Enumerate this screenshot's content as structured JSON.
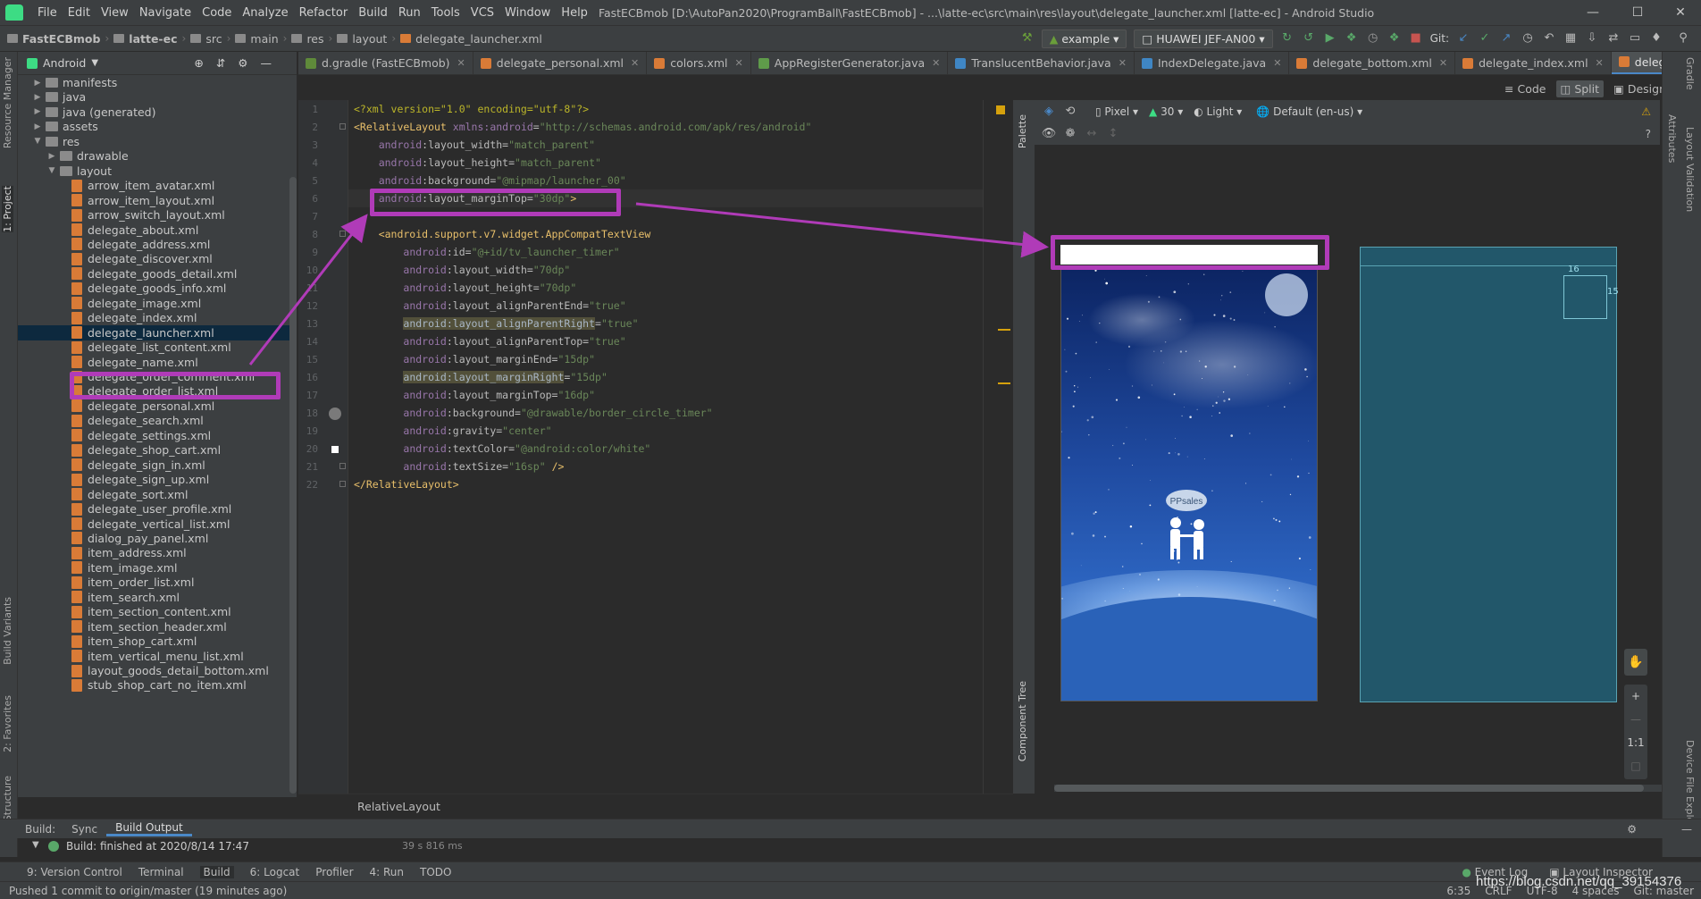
{
  "window": {
    "title": "FastECBmob [D:\\AutoPan2020\\ProgramBall\\FastECBmob] - ...\\latte-ec\\src\\main\\res\\layout\\delegate_launcher.xml [latte-ec] - Android Studio",
    "menu": [
      "File",
      "Edit",
      "View",
      "Navigate",
      "Code",
      "Analyze",
      "Refactor",
      "Build",
      "Run",
      "Tools",
      "VCS",
      "Window",
      "Help"
    ]
  },
  "breadcrumb": [
    "FastECBmob",
    "latte-ec",
    "src",
    "main",
    "res",
    "layout",
    "delegate_launcher.xml"
  ],
  "run": {
    "config": "example",
    "device": "HUAWEI JEF-AN00",
    "git_label": "Git:"
  },
  "project": {
    "view_label": "Android",
    "tree": [
      {
        "depth": 1,
        "type": "folder",
        "label": "manifests",
        "open": false
      },
      {
        "depth": 1,
        "type": "folder",
        "label": "java",
        "open": false
      },
      {
        "depth": 1,
        "type": "folder",
        "label": "java (generated)",
        "open": false
      },
      {
        "depth": 1,
        "type": "folder",
        "label": "assets",
        "open": false
      },
      {
        "depth": 1,
        "type": "folder",
        "label": "res",
        "open": true
      },
      {
        "depth": 2,
        "type": "folder",
        "label": "drawable",
        "open": false
      },
      {
        "depth": 2,
        "type": "folder",
        "label": "layout",
        "open": true
      },
      {
        "depth": 3,
        "type": "file",
        "label": "arrow_item_avatar.xml"
      },
      {
        "depth": 3,
        "type": "file",
        "label": "arrow_item_layout.xml"
      },
      {
        "depth": 3,
        "type": "file",
        "label": "arrow_switch_layout.xml"
      },
      {
        "depth": 3,
        "type": "file",
        "label": "delegate_about.xml"
      },
      {
        "depth": 3,
        "type": "file",
        "label": "delegate_address.xml"
      },
      {
        "depth": 3,
        "type": "file",
        "label": "delegate_discover.xml"
      },
      {
        "depth": 3,
        "type": "file",
        "label": "delegate_goods_detail.xml"
      },
      {
        "depth": 3,
        "type": "file",
        "label": "delegate_goods_info.xml"
      },
      {
        "depth": 3,
        "type": "file",
        "label": "delegate_image.xml"
      },
      {
        "depth": 3,
        "type": "file",
        "label": "delegate_index.xml"
      },
      {
        "depth": 3,
        "type": "file",
        "label": "delegate_launcher.xml",
        "selected": true
      },
      {
        "depth": 3,
        "type": "file",
        "label": "delegate_list_content.xml"
      },
      {
        "depth": 3,
        "type": "file",
        "label": "delegate_name.xml"
      },
      {
        "depth": 3,
        "type": "file",
        "label": "delegate_order_comment.xml"
      },
      {
        "depth": 3,
        "type": "file",
        "label": "delegate_order_list.xml"
      },
      {
        "depth": 3,
        "type": "file",
        "label": "delegate_personal.xml"
      },
      {
        "depth": 3,
        "type": "file",
        "label": "delegate_search.xml"
      },
      {
        "depth": 3,
        "type": "file",
        "label": "delegate_settings.xml"
      },
      {
        "depth": 3,
        "type": "file",
        "label": "delegate_shop_cart.xml"
      },
      {
        "depth": 3,
        "type": "file",
        "label": "delegate_sign_in.xml"
      },
      {
        "depth": 3,
        "type": "file",
        "label": "delegate_sign_up.xml"
      },
      {
        "depth": 3,
        "type": "file",
        "label": "delegate_sort.xml"
      },
      {
        "depth": 3,
        "type": "file",
        "label": "delegate_user_profile.xml"
      },
      {
        "depth": 3,
        "type": "file",
        "label": "delegate_vertical_list.xml"
      },
      {
        "depth": 3,
        "type": "file",
        "label": "dialog_pay_panel.xml"
      },
      {
        "depth": 3,
        "type": "file",
        "label": "item_address.xml"
      },
      {
        "depth": 3,
        "type": "file",
        "label": "item_image.xml"
      },
      {
        "depth": 3,
        "type": "file",
        "label": "item_order_list.xml"
      },
      {
        "depth": 3,
        "type": "file",
        "label": "item_search.xml"
      },
      {
        "depth": 3,
        "type": "file",
        "label": "item_section_content.xml"
      },
      {
        "depth": 3,
        "type": "file",
        "label": "item_section_header.xml"
      },
      {
        "depth": 3,
        "type": "file",
        "label": "item_shop_cart.xml"
      },
      {
        "depth": 3,
        "type": "file",
        "label": "item_vertical_menu_list.xml"
      },
      {
        "depth": 3,
        "type": "file",
        "label": "layout_goods_detail_bottom.xml"
      },
      {
        "depth": 3,
        "type": "file",
        "label": "stub_shop_cart_no_item.xml"
      }
    ]
  },
  "tabs": [
    {
      "label": "d.gradle (FastECBmob)",
      "color": "#5f8a3a"
    },
    {
      "label": "delegate_personal.xml",
      "color": "#d97b37"
    },
    {
      "label": "colors.xml",
      "color": "#d97b37"
    },
    {
      "label": "AppRegisterGenerator.java",
      "color": "#5f9b4a"
    },
    {
      "label": "TranslucentBehavior.java",
      "color": "#3f86c4"
    },
    {
      "label": "IndexDelegate.java",
      "color": "#3f86c4"
    },
    {
      "label": "delegate_bottom.xml",
      "color": "#d97b37"
    },
    {
      "label": "delegate_index.xml",
      "color": "#d97b37"
    },
    {
      "label": "delegate_launcher.xml",
      "color": "#d97b37",
      "active": true
    }
  ],
  "code_lines": [
    {
      "n": "1",
      "parts": [
        [
          "pi",
          "<?xml version=\"1.0\" encoding=\"utf-8\"?>"
        ]
      ]
    },
    {
      "n": "2",
      "parts": [
        [
          "tg",
          "<RelativeLayout "
        ],
        [
          "ns",
          "xmlns:android"
        ],
        [
          "at",
          "="
        ],
        [
          "vl",
          "\"http://schemas.android.com/apk/res/android\""
        ]
      ]
    },
    {
      "n": "3",
      "parts": [
        [
          "at",
          "    "
        ],
        [
          "ns",
          "android"
        ],
        [
          "at",
          ":layout_width="
        ],
        [
          "vl",
          "\"match_parent\""
        ]
      ]
    },
    {
      "n": "4",
      "parts": [
        [
          "at",
          "    "
        ],
        [
          "ns",
          "android"
        ],
        [
          "at",
          ":layout_height="
        ],
        [
          "vl",
          "\"match_parent\""
        ]
      ]
    },
    {
      "n": "5",
      "parts": [
        [
          "at",
          "    "
        ],
        [
          "ns",
          "android"
        ],
        [
          "at",
          ":background="
        ],
        [
          "vl",
          "\"@mipmap/launcher_00\""
        ]
      ]
    },
    {
      "n": "6",
      "parts": [
        [
          "at",
          "    "
        ],
        [
          "ns",
          "android"
        ],
        [
          "at",
          ":layout_marginTop="
        ],
        [
          "vl",
          "\"30dp\""
        ],
        [
          "tg",
          ">"
        ]
      ]
    },
    {
      "n": "7",
      "parts": [
        [
          "at",
          ""
        ]
      ]
    },
    {
      "n": "8",
      "parts": [
        [
          "tg",
          "    <android.support.v7.widget.AppCompatTextView"
        ]
      ]
    },
    {
      "n": "9",
      "parts": [
        [
          "at",
          "        "
        ],
        [
          "ns",
          "android"
        ],
        [
          "at",
          ":id="
        ],
        [
          "vl",
          "\"@+id/tv_launcher_timer\""
        ]
      ]
    },
    {
      "n": "10",
      "parts": [
        [
          "at",
          "        "
        ],
        [
          "ns",
          "android"
        ],
        [
          "at",
          ":layout_width="
        ],
        [
          "vl",
          "\"70dp\""
        ]
      ]
    },
    {
      "n": "11",
      "parts": [
        [
          "at",
          "        "
        ],
        [
          "ns",
          "android"
        ],
        [
          "at",
          ":layout_height="
        ],
        [
          "vl",
          "\"70dp\""
        ]
      ]
    },
    {
      "n": "12",
      "parts": [
        [
          "at",
          "        "
        ],
        [
          "ns",
          "android"
        ],
        [
          "at",
          ":layout_alignParentEnd="
        ],
        [
          "vl",
          "\"true\""
        ]
      ]
    },
    {
      "n": "13",
      "parts": [
        [
          "at",
          "        "
        ],
        [
          "hl",
          "android:layout_alignParentRight"
        ],
        [
          "at",
          "="
        ],
        [
          "vl",
          "\"true\""
        ]
      ]
    },
    {
      "n": "14",
      "parts": [
        [
          "at",
          "        "
        ],
        [
          "ns",
          "android"
        ],
        [
          "at",
          ":layout_alignParentTop="
        ],
        [
          "vl",
          "\"true\""
        ]
      ]
    },
    {
      "n": "15",
      "parts": [
        [
          "at",
          "        "
        ],
        [
          "ns",
          "android"
        ],
        [
          "at",
          ":layout_marginEnd="
        ],
        [
          "vl",
          "\"15dp\""
        ]
      ]
    },
    {
      "n": "16",
      "parts": [
        [
          "at",
          "        "
        ],
        [
          "hl",
          "android:layout_marginRight"
        ],
        [
          "at",
          "="
        ],
        [
          "vl",
          "\"15dp\""
        ]
      ]
    },
    {
      "n": "17",
      "parts": [
        [
          "at",
          "        "
        ],
        [
          "ns",
          "android"
        ],
        [
          "at",
          ":layout_marginTop="
        ],
        [
          "vl",
          "\"16dp\""
        ]
      ]
    },
    {
      "n": "18",
      "parts": [
        [
          "at",
          "        "
        ],
        [
          "ns",
          "android"
        ],
        [
          "at",
          ":background="
        ],
        [
          "vl",
          "\"@drawable/border_circle_timer\""
        ]
      ]
    },
    {
      "n": "19",
      "parts": [
        [
          "at",
          "        "
        ],
        [
          "ns",
          "android"
        ],
        [
          "at",
          ":gravity="
        ],
        [
          "vl",
          "\"center\""
        ]
      ]
    },
    {
      "n": "20",
      "parts": [
        [
          "at",
          "        "
        ],
        [
          "ns",
          "android"
        ],
        [
          "at",
          ":textColor="
        ],
        [
          "vl",
          "\"@android:color/white\""
        ]
      ]
    },
    {
      "n": "21",
      "parts": [
        [
          "at",
          "        "
        ],
        [
          "ns",
          "android"
        ],
        [
          "at",
          ":textSize="
        ],
        [
          "vl",
          "\"16sp\""
        ],
        [
          "tg",
          " />"
        ]
      ]
    },
    {
      "n": "22",
      "parts": [
        [
          "tg",
          "</RelativeLayout>"
        ]
      ]
    }
  ],
  "editor_breadcrumb": "RelativeLayout",
  "design": {
    "modes": [
      "Code",
      "Split",
      "Design"
    ],
    "active_mode": "Split",
    "pixel": "Pixel",
    "api": "30",
    "theme": "Light",
    "locale": "Default (en-us)",
    "palette": "Palette",
    "component_tree": "Component Tree",
    "zoom_fit": "1:1",
    "preview_bubble": "PPsales",
    "blueprint_margin_top": "16",
    "blueprint_margin_end": "15"
  },
  "side_tabs": {
    "left": [
      "Resource Manager",
      "1: Project",
      "Build Variants",
      "2: Favorites",
      "Z: Structure"
    ],
    "right": [
      "Gradle",
      "Attributes",
      "Layout Validation",
      "Device File Explorer"
    ]
  },
  "build": {
    "tabs": [
      "Build:",
      "Sync",
      "Build Output"
    ],
    "status": "Build: finished at 2020/8/14 17:47",
    "duration": "39 s 816 ms"
  },
  "toolwindows": [
    "9: Version Control",
    "Terminal",
    "Build",
    "6: Logcat",
    "Profiler",
    "4: Run",
    "TODO"
  ],
  "toolwindows_right": [
    "Event Log",
    "Layout Inspector"
  ],
  "status": {
    "message": "Pushed 1 commit to origin/master (19 minutes ago)",
    "position": "6:35",
    "line_sep": "CRLF",
    "encoding": "UTF-8",
    "indent": "4 spaces",
    "branch": "Git: master",
    "watermark": "https://blog.csdn.net/qq_39154376"
  },
  "colors": {
    "accent": "#b03bb8",
    "selection": "#0d293e",
    "tab_underline": "#4a88c7"
  }
}
